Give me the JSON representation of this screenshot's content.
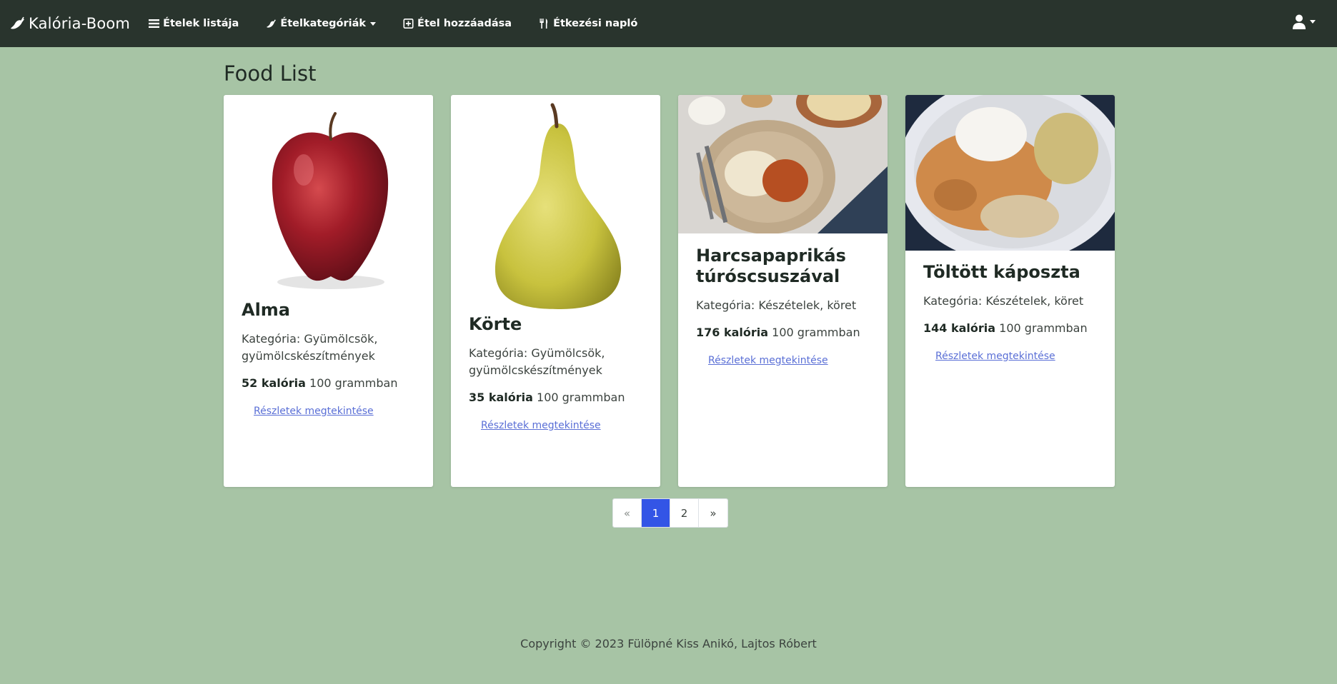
{
  "nav": {
    "brand": "Kalória-Boom",
    "items": [
      {
        "label": "Ételek listája",
        "icon": "list-icon"
      },
      {
        "label": "Ételkategóriák",
        "icon": "pepper-icon",
        "dropdown": true
      },
      {
        "label": "Étel hozzáadása",
        "icon": "plus-square-icon"
      },
      {
        "label": "Étkezési napló",
        "icon": "utensils-icon"
      }
    ],
    "user_icon": "user-icon"
  },
  "page": {
    "title": "Food List"
  },
  "cards": [
    {
      "name": "Alma",
      "category": "Kategória: Gyümölcsök, gyümölcskészítmények",
      "calories": "52 kalória",
      "unit": "100 grammban",
      "link": "Részletek megtekintése",
      "image": "red apple"
    },
    {
      "name": "Körte",
      "category": "Kategória: Gyümölcsök, gyümölcskészítmények",
      "calories": "35 kalória",
      "unit": "100 grammban",
      "link": "Részletek megtekintése",
      "image": "pear"
    },
    {
      "name": "Harcsapaprikás túróscsuszával",
      "category": "Kategória: Készételek, köret",
      "calories": "176 kalória",
      "unit": "100 grammban",
      "link": "Részletek megtekintése",
      "image": "plated dish with noodles"
    },
    {
      "name": "Töltött káposzta",
      "category": "Kategória: Készételek, köret",
      "calories": "144 kalória",
      "unit": "100 grammban",
      "link": "Részletek megtekintése",
      "image": "stuffed cabbage with sauerkraut"
    }
  ],
  "pagination": {
    "prev": "«",
    "pages": [
      "1",
      "2"
    ],
    "current": "1",
    "next": "»"
  },
  "footer": {
    "text": "Copyright © 2023 Fülöpné Kiss Anikó, Lajtos Róbert"
  },
  "colors": {
    "navbar": "#29342d",
    "background": "#a7c4a5",
    "active_page": "#3355e6",
    "link": "#5a6fd6"
  }
}
